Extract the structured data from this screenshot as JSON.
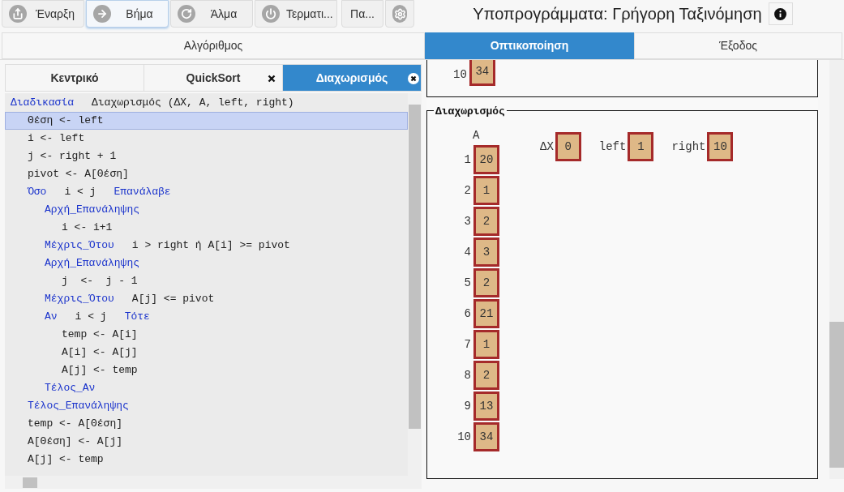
{
  "toolbar": {
    "buttons": [
      {
        "label": "Έναρξη",
        "kind": "share",
        "selected": false
      },
      {
        "label": "Βήμα",
        "kind": "arrow",
        "selected": true
      },
      {
        "label": "Άλμα",
        "kind": "redo",
        "selected": false
      },
      {
        "label": "Τερματι...",
        "kind": "power",
        "selected": false
      },
      {
        "label": "Πα...",
        "kind": "text",
        "selected": false
      },
      {
        "kind": "settings",
        "selected": false
      }
    ]
  },
  "title": "Υποπρογράμματα: Γρήγορη Ταξινόμηση",
  "main_tabs": [
    {
      "label": "Αλγόριθμος",
      "selected": false
    },
    {
      "label": "Οπτικοποίηση",
      "selected": true
    },
    {
      "label": "Έξοδος",
      "selected": false
    }
  ],
  "code_tabs": [
    {
      "label": "Κεντρικό",
      "selected": false,
      "closable": false
    },
    {
      "label": "QuickSort",
      "selected": false,
      "closable": true
    },
    {
      "label": "Διαχωρισμός",
      "selected": true,
      "closable": true
    }
  ],
  "code": [
    {
      "parts": [
        {
          "kind": "keyword",
          "text": "Διαδικασία"
        },
        {
          "kind": "code",
          "text": "Διαχωρισμός (ΔX, A, left, right)"
        }
      ],
      "selected": false,
      "children": [
        {
          "parts": [
            {
              "kind": "code",
              "text": "Θέση <- left"
            }
          ],
          "selected": true
        },
        {
          "parts": [
            {
              "kind": "code",
              "text": "i <- left"
            }
          ],
          "selected": false
        },
        {
          "parts": [
            {
              "kind": "code",
              "text": "j <- right + 1"
            }
          ],
          "selected": false
        },
        {
          "parts": [
            {
              "kind": "code",
              "text": "pivot <- A[Θέση]"
            }
          ],
          "selected": false
        },
        {
          "parts": [
            {
              "kind": "keyword",
              "text": "Όσο"
            },
            {
              "kind": "code",
              "text": "i < j"
            },
            {
              "kind": "keyword",
              "text": "Επανάλαβε"
            }
          ],
          "selected": false,
          "children": [
            {
              "parts": [
                {
                  "kind": "keyword",
                  "text": "Αρχή_Επανάληψης"
                }
              ],
              "selected": false,
              "children": [
                {
                  "parts": [
                    {
                      "kind": "code",
                      "text": "i <- i+1"
                    }
                  ],
                  "selected": false
                }
              ]
            },
            {
              "parts": [
                {
                  "kind": "keyword",
                  "text": "Μέχρις_Ότου"
                },
                {
                  "kind": "code",
                  "text": "i > right ή A[i] >= pivot"
                }
              ],
              "selected": false
            },
            {
              "parts": [
                {
                  "kind": "keyword",
                  "text": "Αρχή_Επανάληψης"
                }
              ],
              "selected": false,
              "children": [
                {
                  "parts": [
                    {
                      "kind": "code",
                      "text": "j  <-  j - 1"
                    }
                  ],
                  "selected": false
                }
              ]
            },
            {
              "parts": [
                {
                  "kind": "keyword",
                  "text": "Μέχρις_Ότου"
                },
                {
                  "kind": "code",
                  "text": "A[j] <= pivot"
                }
              ],
              "selected": false
            },
            {
              "parts": [
                {
                  "kind": "keyword",
                  "text": "Αν"
                },
                {
                  "kind": "code",
                  "text": "i < j"
                },
                {
                  "kind": "keyword",
                  "text": "Τότε"
                }
              ],
              "selected": false,
              "children": [
                {
                  "parts": [
                    {
                      "kind": "code",
                      "text": "temp <- A[i]"
                    }
                  ],
                  "selected": false
                },
                {
                  "parts": [
                    {
                      "kind": "code",
                      "text": "A[i] <- A[j]"
                    }
                  ],
                  "selected": false
                },
                {
                  "parts": [
                    {
                      "kind": "code",
                      "text": "A[j] <- temp"
                    }
                  ],
                  "selected": false
                }
              ]
            },
            {
              "parts": [
                {
                  "kind": "keyword",
                  "text": "Τέλος_Αν"
                }
              ],
              "selected": false
            }
          ]
        },
        {
          "parts": [
            {
              "kind": "keyword",
              "text": "Τέλος_Επανάληψης"
            }
          ],
          "selected": false
        },
        {
          "parts": [
            {
              "kind": "code",
              "text": "temp <- A[Θέση]"
            }
          ],
          "selected": false
        },
        {
          "parts": [
            {
              "kind": "code",
              "text": "A[Θέση] <- A[j]"
            }
          ],
          "selected": false
        },
        {
          "parts": [
            {
              "kind": "code",
              "text": "A[j] <- temp"
            }
          ],
          "selected": false
        }
      ]
    }
  ],
  "visualization": {
    "previous_cell": {
      "index": "10",
      "value": "34"
    },
    "frame": {
      "title": "Διαχωρισμός",
      "array": {
        "name": "A",
        "items": [
          {
            "index": "1",
            "value": "20"
          },
          {
            "index": "2",
            "value": "1"
          },
          {
            "index": "3",
            "value": "2"
          },
          {
            "index": "4",
            "value": "3"
          },
          {
            "index": "5",
            "value": "2"
          },
          {
            "index": "6",
            "value": "21"
          },
          {
            "index": "7",
            "value": "1"
          },
          {
            "index": "8",
            "value": "2"
          },
          {
            "index": "9",
            "value": "13"
          },
          {
            "index": "10",
            "value": "34"
          }
        ]
      },
      "variables": [
        {
          "name": "ΔX",
          "value": "0"
        },
        {
          "name": "left",
          "value": "1"
        },
        {
          "name": "right",
          "value": "10"
        }
      ]
    }
  }
}
